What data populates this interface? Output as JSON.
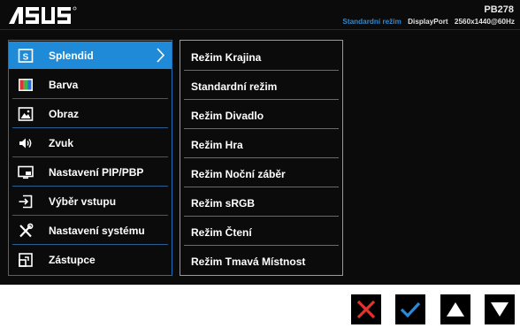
{
  "header": {
    "brand": "ASUS",
    "model": "PB278",
    "mode": "Standardní režim",
    "port": "DisplayPort",
    "resolution": "2560x1440@60Hz"
  },
  "menu": {
    "items": [
      {
        "label": "Splendid",
        "icon": "splendid-s-icon",
        "selected": true
      },
      {
        "label": "Barva",
        "icon": "color-bars-icon"
      },
      {
        "label": "Obraz",
        "icon": "picture-icon"
      },
      {
        "label": "Zvuk",
        "icon": "speaker-icon"
      },
      {
        "label": "Nastavení PIP/PBP",
        "icon": "pip-icon"
      },
      {
        "label": "Výběr vstupu",
        "icon": "input-select-icon"
      },
      {
        "label": "Nastavení systému",
        "icon": "tools-icon"
      },
      {
        "label": "Zástupce",
        "icon": "shortcut-icon"
      }
    ]
  },
  "submenu": {
    "items": [
      {
        "label": "Režim Krajina"
      },
      {
        "label": "Standardní režim"
      },
      {
        "label": "Režim Divadlo"
      },
      {
        "label": "Režim Hra"
      },
      {
        "label": "Režim Noční záběr"
      },
      {
        "label": "Režim sRGB"
      },
      {
        "label": "Režim Čtení"
      },
      {
        "label": "Režim Tmavá Místnost"
      }
    ]
  },
  "colors": {
    "osd_background": "#0b0b0b",
    "selected": "#1f8ad8",
    "accent": "#2a8ad8",
    "close_red": "#e5322d",
    "confirm_blue": "#2a8ad8"
  },
  "navigation": [
    {
      "icon": "close-icon"
    },
    {
      "icon": "checkmark-icon"
    },
    {
      "icon": "triangle-up-icon"
    },
    {
      "icon": "triangle-down-icon"
    }
  ]
}
